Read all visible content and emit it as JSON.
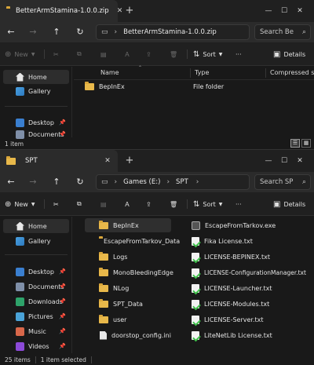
{
  "window1": {
    "tab_title": "BetterArmStamina-1.0.0.zip",
    "path": [
      "BetterArmStamina-1.0.0.zip"
    ],
    "search_placeholder": "Search Be",
    "toolbar": {
      "new": "New",
      "sort": "Sort",
      "details": "Details"
    },
    "columns": {
      "name": "Name",
      "type": "Type",
      "size": "Compressed size"
    },
    "files": [
      {
        "name": "BepInEx",
        "type": "File folder",
        "kind": "folder"
      }
    ],
    "sidebar": [
      {
        "label": "Home",
        "icon": "home-icon",
        "selected": true
      },
      {
        "label": "Gallery",
        "icon": "gallery-icon"
      },
      {
        "label": "Desktop",
        "icon": "desktop-icon",
        "pinned": true
      },
      {
        "label": "Documents",
        "icon": "documents-icon",
        "pinned": true
      }
    ],
    "status": {
      "count": "1 item"
    }
  },
  "window2": {
    "tab_title": "SPT",
    "path": [
      "Games (E:)",
      "SPT"
    ],
    "search_placeholder": "Search SP",
    "toolbar": {
      "new": "New",
      "sort": "Sort",
      "details": "Details"
    },
    "sidebar": [
      {
        "label": "Home",
        "icon": "home-icon",
        "selected": true
      },
      {
        "label": "Gallery",
        "icon": "gallery-icon"
      },
      {
        "label": "Desktop",
        "icon": "desktop-icon",
        "pinned": true
      },
      {
        "label": "Documents",
        "icon": "documents-icon",
        "pinned": true
      },
      {
        "label": "Downloads",
        "icon": "downloads-icon",
        "pinned": true
      },
      {
        "label": "Pictures",
        "icon": "pictures-icon",
        "pinned": true
      },
      {
        "label": "Music",
        "icon": "music-icon",
        "pinned": true
      },
      {
        "label": "Videos",
        "icon": "videos-icon",
        "pinned": true
      }
    ],
    "files_col1": [
      {
        "name": "BepInEx",
        "kind": "folder",
        "selected": true
      },
      {
        "name": "EscapeFromTarkov_Data",
        "kind": "folder"
      },
      {
        "name": "Logs",
        "kind": "folder"
      },
      {
        "name": "MonoBleedingEdge",
        "kind": "folder"
      },
      {
        "name": "NLog",
        "kind": "folder"
      },
      {
        "name": "SPT_Data",
        "kind": "folder"
      },
      {
        "name": "user",
        "kind": "folder"
      },
      {
        "name": "doorstop_config.ini",
        "kind": "file"
      }
    ],
    "files_col2": [
      {
        "name": "EscapeFromTarkov.exe",
        "kind": "exe"
      },
      {
        "name": "Fika License.txt",
        "kind": "txt"
      },
      {
        "name": "LICENSE-BEPINEX.txt",
        "kind": "txt"
      },
      {
        "name": "LICENSE-ConfigurationManager.txt",
        "kind": "txt"
      },
      {
        "name": "LICENSE-Launcher.txt",
        "kind": "txt"
      },
      {
        "name": "LICENSE-Modules.txt",
        "kind": "txt"
      },
      {
        "name": "LICENSE-Server.txt",
        "kind": "txt"
      },
      {
        "name": "LiteNetLib License.txt",
        "kind": "txt"
      }
    ],
    "status": {
      "count": "25 items",
      "selected": "1 item selected"
    }
  }
}
